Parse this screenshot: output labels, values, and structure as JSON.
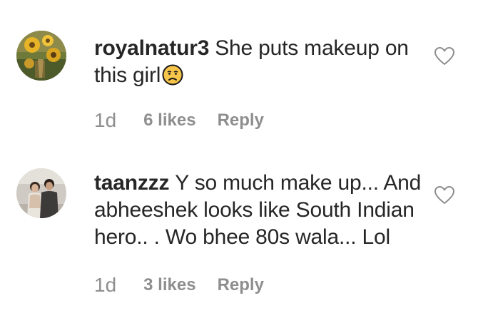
{
  "comments": [
    {
      "username": "royalnatur3",
      "text": "She puts makeup on this girl",
      "emoji_icon": "unamused-face-emoji-icon",
      "time": "1d",
      "likes": "6 likes",
      "reply_label": "Reply",
      "avatar_icon": "sunflower-photo-avatar"
    },
    {
      "username": "taanzzz",
      "text": "Y so much make up... And abheeshek looks like South Indian hero.. . Wo bhee 80s wala... Lol",
      "time": "1d",
      "likes": "3 likes",
      "reply_label": "Reply",
      "avatar_icon": "couple-photo-avatar"
    }
  ],
  "colors": {
    "text": "#262626",
    "secondary": "#8e8e8e",
    "emoji_face": "#f7c54a",
    "emoji_outline": "#1a1a1a"
  }
}
